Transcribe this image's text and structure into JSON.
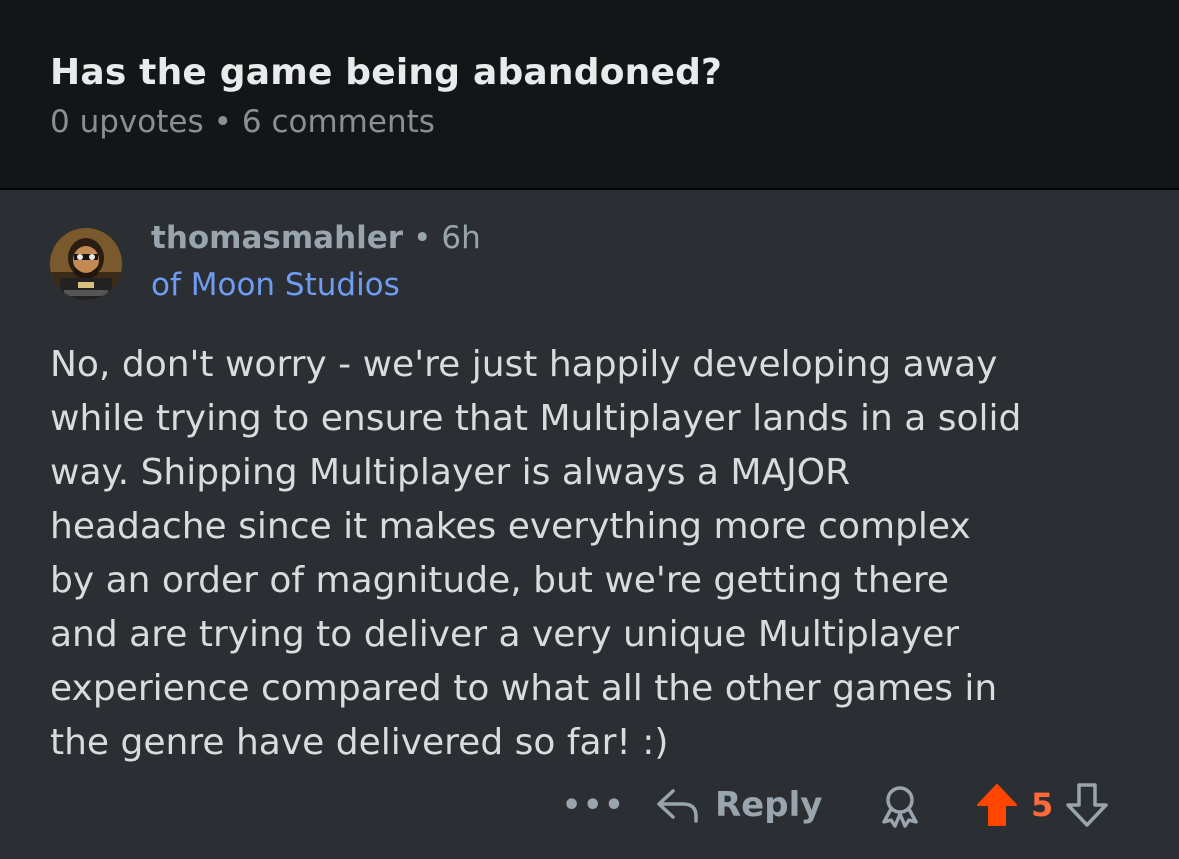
{
  "post": {
    "title": "Has the game being abandoned?",
    "upvotes": "0 upvotes",
    "separator": "•",
    "comments": "6 comments"
  },
  "comment": {
    "author": "thomasmahler",
    "separator": "•",
    "time": "6h",
    "flair": "of Moon Studios",
    "body": "No, don't worry - we're just happily developing away\nwhile trying to ensure that Multiplayer lands in a solid\nway. Shipping Multiplayer is always a MAJOR\nheadache since it makes everything more complex\nby an order of magnitude, but we're getting there\nand are trying to deliver a very unique Multiplayer\nexperience compared to what all the other games in\nthe genre have delivered so far! :)",
    "actions": {
      "more": "•••",
      "reply": "Reply",
      "score": "5"
    }
  },
  "colors": {
    "upvote_active": "#ff4500",
    "score": "#ff6a3c",
    "flair": "#6f9cf2",
    "muted": "#9aa4ad"
  },
  "icons": [
    "reply-arrow-icon",
    "award-icon",
    "upvote-arrow-icon",
    "downvote-arrow-icon"
  ]
}
